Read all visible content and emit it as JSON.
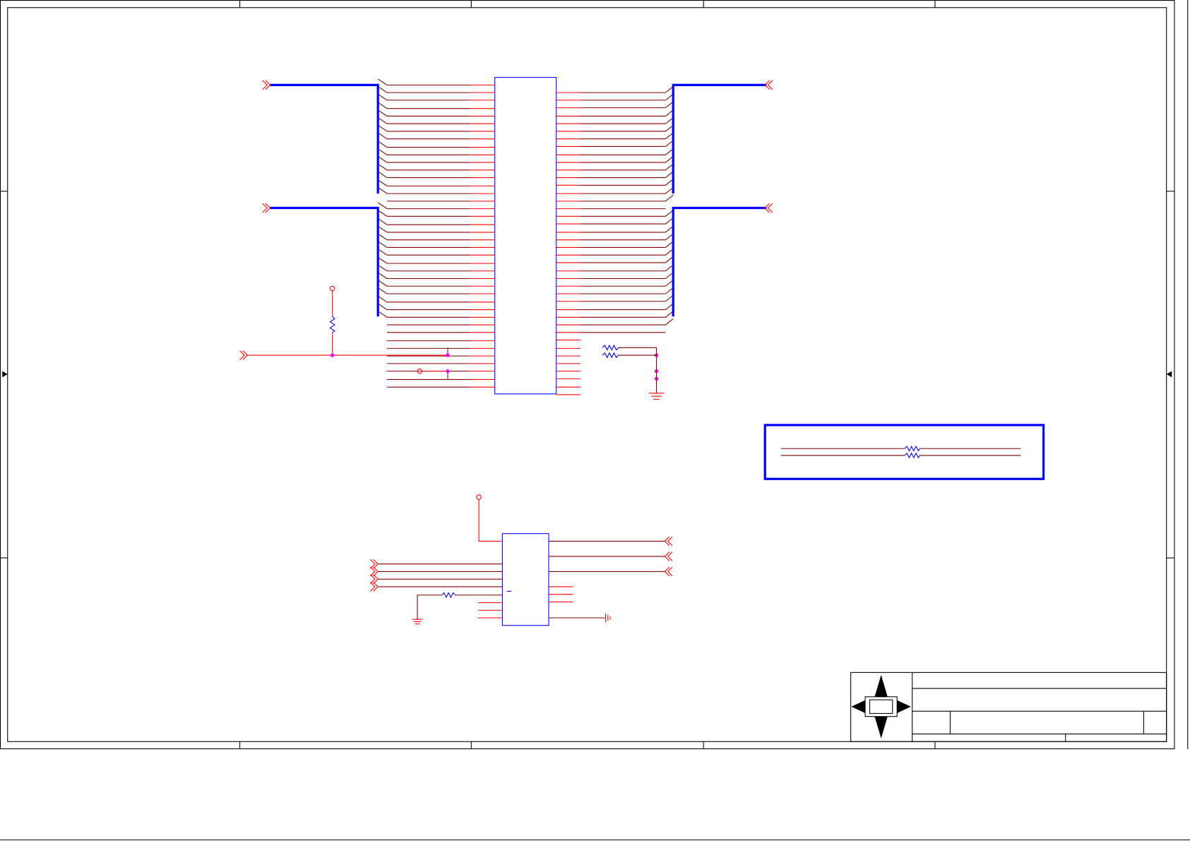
{
  "schematic": {
    "title": "",
    "sheet_frame": {
      "zones_horizontal": 5,
      "zones_vertical": 4
    },
    "colors": {
      "border": "#000000",
      "wire": "#ff0000",
      "net": "#800000",
      "bus": "#0000ff",
      "component_outline": "#0000ff",
      "junction": "#ff00ff"
    },
    "components": {
      "connector_main": {
        "label": "",
        "left_pins": 40,
        "right_pins": 40
      },
      "ic_lower": {
        "label": "",
        "pin_mark": "—"
      },
      "resistors": 6,
      "power_nodes": 3,
      "grounds": 3
    },
    "note_box": {
      "label": ""
    },
    "title_block": {
      "logo_icon": "compass-arrow-logo",
      "title": "",
      "size": "",
      "document_number": "",
      "revision": "",
      "date": "",
      "sheet": ""
    }
  }
}
